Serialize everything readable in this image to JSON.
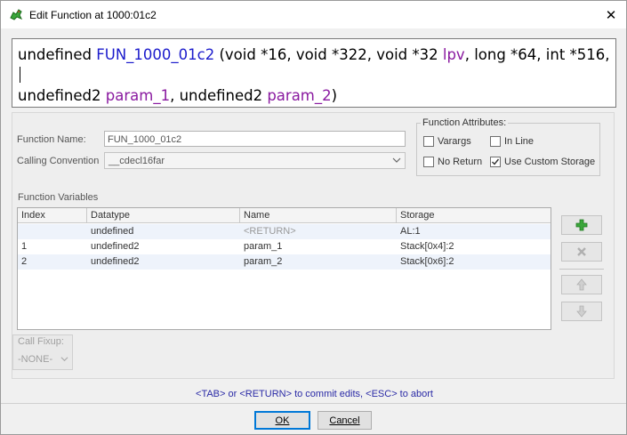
{
  "window": {
    "title": "Edit Function at 1000:01c2",
    "close_glyph": "✕"
  },
  "signature": {
    "t1": "undefined ",
    "t2": "FUN_1000_01c2",
    "t3": " (void *16, void *322, void *32 ",
    "t4": "lpv",
    "t5": ", long *64, int *516, ",
    "t6": "undefined2 ",
    "t7": "param_1",
    "t8": ", undefined2 ",
    "t9": "param_2",
    "t10": ")"
  },
  "form": {
    "function_name_label": "Function Name:",
    "function_name_value": "FUN_1000_01c2",
    "calling_convention_label": "Calling Convention",
    "calling_convention_value": "__cdecl16far",
    "dropdown_glyph": "⌄"
  },
  "attributes": {
    "legend": "Function Attributes:",
    "varargs": {
      "label": "Varargs",
      "checked": false
    },
    "inline": {
      "label": "In Line",
      "checked": false
    },
    "no_return": {
      "label": "No Return",
      "checked": false
    },
    "custom_storage": {
      "label": "Use Custom Storage",
      "checked": true
    }
  },
  "variables": {
    "section_label": "Function Variables",
    "columns": [
      "Index",
      "Datatype",
      "Name",
      "Storage"
    ],
    "rows": [
      {
        "index": "",
        "datatype": "undefined",
        "name": "<RETURN>",
        "storage": "AL:1"
      },
      {
        "index": "1",
        "datatype": "undefined2",
        "name": "param_1",
        "storage": "Stack[0x4]:2"
      },
      {
        "index": "2",
        "datatype": "undefined2",
        "name": "param_2",
        "storage": "Stack[0x6]:2"
      }
    ]
  },
  "fixup": {
    "label": "Call Fixup:",
    "value": "-NONE-"
  },
  "footer": {
    "hint": "<TAB> or <RETURN> to commit edits, <ESC> to abort",
    "ok_label": "OK",
    "cancel_label": "Cancel"
  },
  "colors": {
    "function_name": "#1c1ccc",
    "parameter_name": "#8a1aa0",
    "hint_text": "#2a2aa6",
    "add_icon": "#3aa63a"
  }
}
